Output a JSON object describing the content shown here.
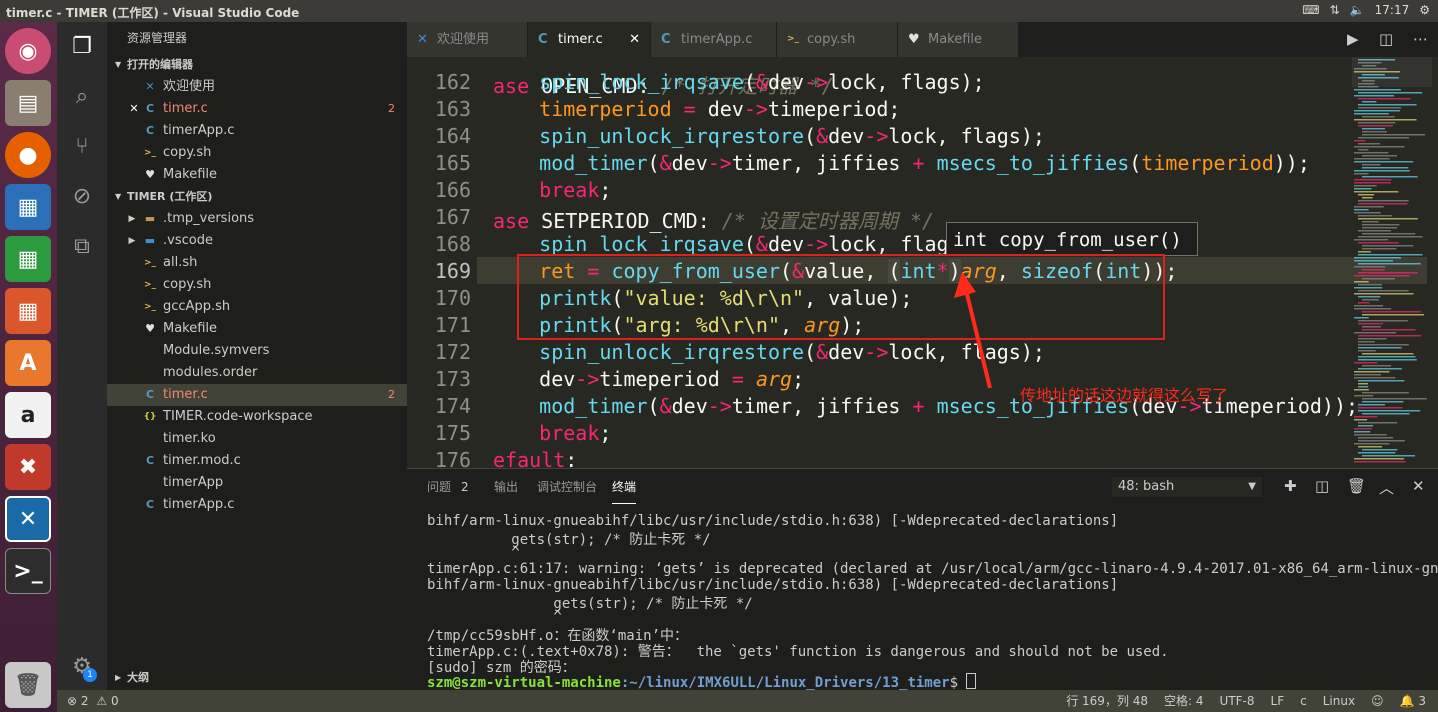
{
  "window": {
    "title": "timer.c - TIMER (工作区) - Visual Studio Code",
    "clock": "17:17",
    "tray_icons": [
      "keyboard-icon",
      "network-icon",
      "volume-icon",
      "power-icon"
    ]
  },
  "launcher": {
    "apps": [
      "ubuntu-dash-icon",
      "files-icon",
      "firefox-icon",
      "writer-icon",
      "calc-icon",
      "impress-icon",
      "software-center-icon",
      "amazon-icon",
      "settings-icon",
      "vscode-icon",
      "terminal-icon",
      "trash-icon"
    ]
  },
  "activity_bar": {
    "items": [
      "explorer-icon",
      "search-icon",
      "source-control-icon",
      "debug-icon",
      "extensions-icon"
    ],
    "settings_badge": "1"
  },
  "sidebar": {
    "header": "资源管理器",
    "open_editors": {
      "title": "打开的编辑器",
      "items": [
        {
          "label": "欢迎使用",
          "icon": "vscode-icon",
          "badge": ""
        },
        {
          "label": "timer.c",
          "icon": "c-icon",
          "badge": "2"
        },
        {
          "label": "timerApp.c",
          "icon": "c-icon",
          "badge": ""
        },
        {
          "label": "copy.sh",
          "icon": "shell-icon",
          "badge": ""
        },
        {
          "label": "Makefile",
          "icon": "makefile-icon",
          "badge": ""
        }
      ]
    },
    "workspace": {
      "title": "TIMER (工作区)",
      "items": [
        {
          "label": ".tmp_versions",
          "icon": "folder-icon",
          "badge": ""
        },
        {
          "label": ".vscode",
          "icon": "vscode-folder-icon",
          "badge": ""
        },
        {
          "label": "all.sh",
          "icon": "shell-icon",
          "badge": ""
        },
        {
          "label": "copy.sh",
          "icon": "shell-icon",
          "badge": ""
        },
        {
          "label": "gccApp.sh",
          "icon": "shell-icon",
          "badge": ""
        },
        {
          "label": "Makefile",
          "icon": "makefile-icon",
          "badge": ""
        },
        {
          "label": "Module.symvers",
          "icon": "file-icon",
          "badge": ""
        },
        {
          "label": "modules.order",
          "icon": "file-icon",
          "badge": ""
        },
        {
          "label": "timer.c",
          "icon": "c-icon",
          "badge": "2"
        },
        {
          "label": "TIMER.code-workspace",
          "icon": "json-icon",
          "badge": ""
        },
        {
          "label": "timer.ko",
          "icon": "file-icon",
          "badge": ""
        },
        {
          "label": "timer.mod.c",
          "icon": "c-icon",
          "badge": ""
        },
        {
          "label": "timerApp",
          "icon": "file-icon",
          "badge": ""
        },
        {
          "label": "timerApp.c",
          "icon": "c-icon",
          "badge": ""
        }
      ]
    },
    "outline": {
      "title": "大纲"
    }
  },
  "tabs": [
    {
      "label": "欢迎使用",
      "icon": "vscode-icon",
      "active": false
    },
    {
      "label": "timer.c",
      "icon": "c-icon",
      "active": true
    },
    {
      "label": "timerApp.c",
      "icon": "c-icon",
      "active": false
    },
    {
      "label": "copy.sh",
      "icon": "shell-icon",
      "active": false
    },
    {
      "label": "Makefile",
      "icon": "makefile-icon",
      "active": false
    }
  ],
  "editor_actions": [
    "run-icon",
    "split-editor-icon",
    "more-icon"
  ],
  "editor": {
    "line_numbers": [
      "162",
      "163",
      "164",
      "165",
      "166",
      "167",
      "168",
      "169",
      "170",
      "171",
      "172",
      "173",
      "174",
      "175",
      "176"
    ],
    "hover_tooltip": "int copy_from_user()",
    "annotation": "传地址的话这边就得这么写了"
  },
  "panel": {
    "tabs": [
      "问题",
      "输出",
      "调试控制台",
      "终端"
    ],
    "problems_count": "2",
    "terminal_select": "48: bash",
    "actions": [
      "add-icon",
      "split-icon",
      "trash-icon",
      "maximize-icon",
      "close-icon"
    ],
    "lines": [
      "bihf/arm-linux-gnueabihf/libc/usr/include/stdio.h:638) [-Wdeprecated-declarations]",
      "          gets(str); /* 防止卡死 */",
      "          ^",
      "timerApp.c:61:17: warning: ‘gets’ is deprecated (declared at /usr/local/arm/gcc-linaro-4.9.4-2017.01-x86_64_arm-linux-gnuea",
      "bihf/arm-linux-gnueabihf/libc/usr/include/stdio.h:638) [-Wdeprecated-declarations]",
      "               gets(str); /* 防止卡死 */",
      "               ^",
      "/tmp/cc59sbHf.o：在函数‘main’中：",
      "timerApp.c:(.text+0x78): 警告：  the `gets' function is dangerous and should not be used.",
      "[sudo] szm 的密码："
    ],
    "prompt_user": "szm@szm-virtual-machine",
    "prompt_path": ":~/linux/IMX6ULL/Linux_Drivers/13_timer",
    "prompt_symbol": "$ "
  },
  "status": {
    "errors": "2",
    "warnings": "0",
    "position": "行 169，列 48",
    "spaces": "空格: 4",
    "encoding": "UTF-8",
    "eol": "LF",
    "language": "c",
    "os": "Linux",
    "notifications": "3"
  }
}
